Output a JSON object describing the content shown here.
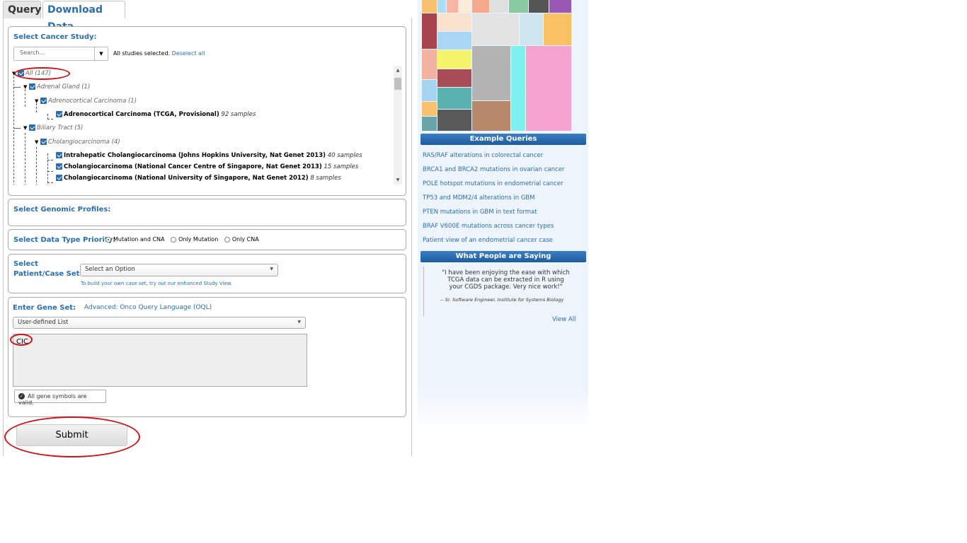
{
  "tabs": {
    "query": "Query",
    "download": "Download Data"
  },
  "study": {
    "label": "Select Cancer Study:",
    "search_placeholder": "Search...",
    "all_selected": "All studies selected.",
    "deselect": "Deselect all",
    "tree": {
      "all": "All (147)",
      "adrenal": "Adrenal Gland (1)",
      "adrenocortical": "Adrenocortical Carcinoma (1)",
      "acc_study": "Adrenocortical Carcinoma (TCGA, Provisional)",
      "acc_samples": "92 samples",
      "biliary": "Biliary Tract (5)",
      "cholangio": "Cholangiocarcinoma (4)",
      "s1": "Intrahepatic Cholangiocarcinoma (Johns Hopkins University, Nat Genet 2013)",
      "s1_samples": "40 samples",
      "s2": "Cholangiocarcinoma (National Cancer Centre of Singapore, Nat Genet 2013)",
      "s2_samples": "15 samples",
      "s3": "Cholangiocarcinoma (National University of Singapore, Nat Genet 2012)",
      "s3_samples": "8 samples"
    }
  },
  "profiles": {
    "label": "Select Genomic Profiles:"
  },
  "priority": {
    "label": "Select Data Type Priority:",
    "options": [
      "Mutation and CNA",
      "Only Mutation",
      "Only CNA"
    ],
    "selected": "Mutation and CNA"
  },
  "caseset": {
    "label_line1": "Select",
    "label_line2": "Patient/Case Set:",
    "selected": "Select an Option",
    "hint": "To build your own case set, try out our enhanced Study View."
  },
  "geneset": {
    "label": "Enter Gene Set:",
    "oql_link": "Advanced: Onco Query Language (OQL)",
    "list_selected": "User-defined List",
    "value": "CIC",
    "valid_msg": "All gene symbols are valid."
  },
  "submit_label": "Submit",
  "sidebar": {
    "example_header": "Example Queries",
    "examples": [
      "RAS/RAF alterations in colorectal cancer",
      "BRCA1 and BRCA2 mutations in ovarian cancer",
      "POLE hotspot mutations in endometrial cancer",
      "TP53 and MDM2/4 alterations in GBM",
      "PTEN mutations in GBM in text format",
      "BRAF V600E mutations across cancer types",
      "Patient view of an endometrial cancer case"
    ],
    "saying_header": "What People are Saying",
    "quote": "\"I have been enjoying the ease with which TCGA data can be extracted in R using your CGDS package. Very nice work!\"",
    "quote_source": "-- Sr. Software Engineer, Institute for Systems Biology",
    "view_all": "View All"
  },
  "colors": {
    "accent": "#2a6eb1",
    "highlight": "#d0121a"
  }
}
